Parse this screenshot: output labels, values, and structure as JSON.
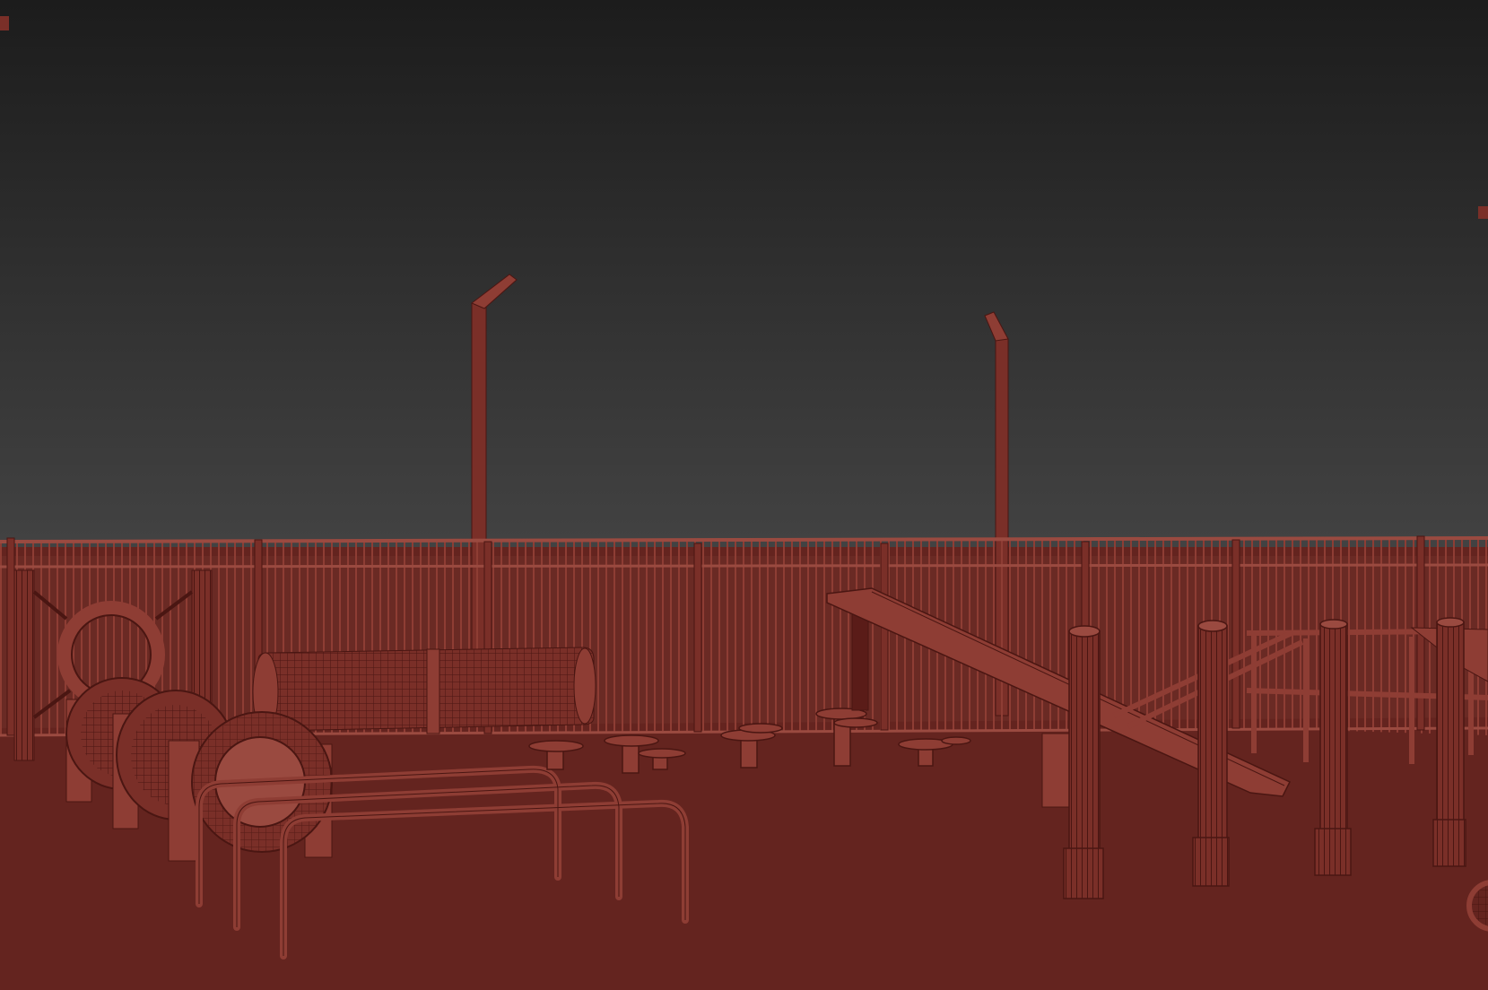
{
  "viewport": {
    "shading_mode": "wireframe-over-shaded",
    "background_top": "#1c1c1c",
    "background_bottom": "#434343",
    "ground_color": "#64241f",
    "wire_color": "#8e3d34",
    "object_fill": "#7a2f28",
    "object_light": "#9a4a40"
  },
  "objects": [
    "fence",
    "light-pole-left",
    "light-pole-right",
    "tire-ring-jump",
    "barrel-tunnel-left",
    "barrel-tunnel-middle",
    "barrel-tunnel-front",
    "crawl-tunnel",
    "hurdle-bars",
    "stepping-stools",
    "seesaw-ramp",
    "weave-posts",
    "a-frame-platform",
    "electrical-box"
  ]
}
